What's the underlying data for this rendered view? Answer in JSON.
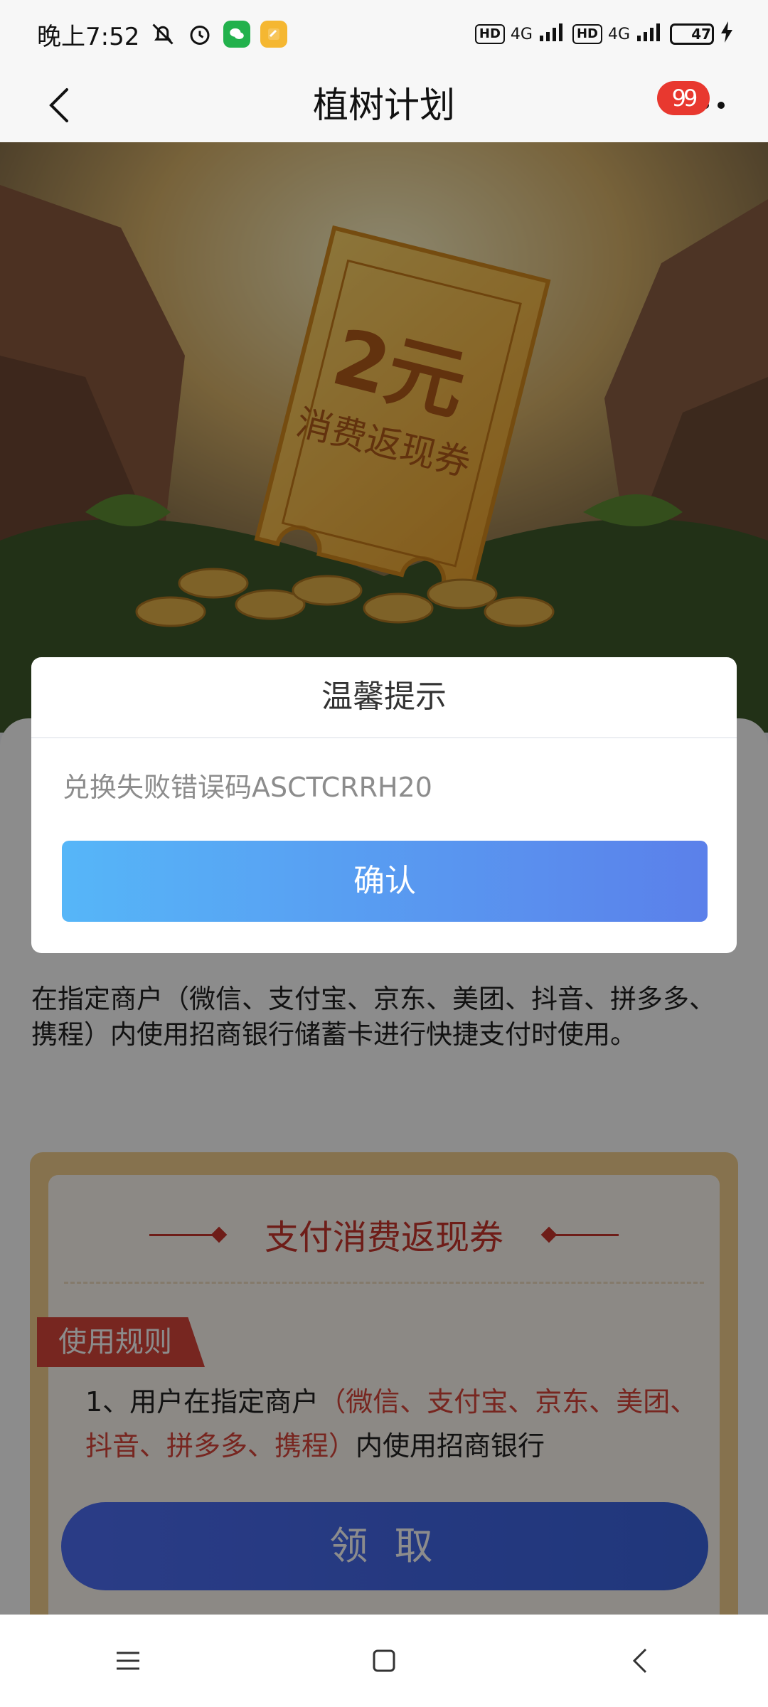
{
  "status_bar": {
    "time": "晚上7:52",
    "network_1": "4G",
    "network_2": "4G",
    "hd": "HD",
    "battery": "47"
  },
  "header": {
    "title": "植树计划",
    "badge_count": "99"
  },
  "hero": {
    "amount": "2元",
    "voucher_text": "消费返现券"
  },
  "dialog": {
    "title": "温馨提示",
    "message": "兑换失败错误码ASCTCRRH20",
    "confirm_label": "确认"
  },
  "content": {
    "description": "在指定商户（微信、支付宝、京东、美团、抖音、拼多多、携程）内使用招商银行储蓄卡进行快捷支付时使用。",
    "voucher_title": "支付消费返现券",
    "rule_tag": "使用规则",
    "rule_prefix": "1、用户在指定商户",
    "rule_highlight": "（微信、支付宝、京东、美团、抖音、拼多多、携程）",
    "rule_suffix": "内使用招商银行",
    "claim_label": "领 取"
  },
  "colors": {
    "accent": "#5b80ea",
    "badge": "#e8382f",
    "rule_red": "#d9453b"
  }
}
